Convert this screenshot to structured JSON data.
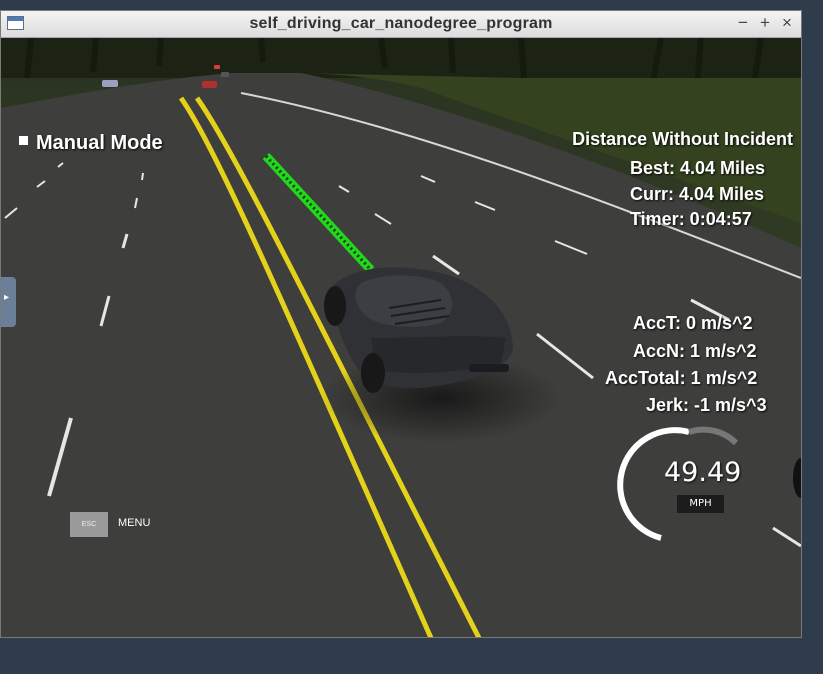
{
  "window": {
    "title": "self_driving_car_nanodegree_program",
    "controls": {
      "minimize": "−",
      "maximize": "+",
      "close": "×"
    }
  },
  "hud": {
    "mode": "Manual Mode",
    "distance_title": "Distance Without Incident",
    "best": "Best: 4.04 Miles",
    "curr": "Curr: 4.04 Miles",
    "timer": "Timer: 0:04:57",
    "acc_t": "AccT: 0 m/s^2",
    "acc_n": "AccN: 1 m/s^2",
    "acc_total": "AccTotal: 1 m/s^2",
    "jerk": "Jerk: -1 m/s^3"
  },
  "speedometer": {
    "value": "49.49",
    "unit": "MPH",
    "gauge_fraction": 0.55
  },
  "menu": {
    "esc_label": "ESC",
    "menu_label": "MENU"
  },
  "colors": {
    "road": "#3d3d3b",
    "grass": "#2f3a1c",
    "lane_yellow": "#e3d11a",
    "path_green": "#22d61c"
  }
}
